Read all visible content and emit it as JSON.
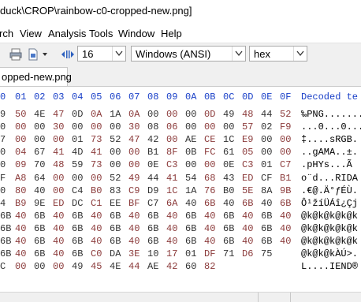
{
  "window": {
    "title": "duck\\CROP\\rainbow-c0-cropped-new.png]"
  },
  "menu": [
    "rch",
    "View",
    "Analysis",
    "Tools",
    "Window",
    "Help"
  ],
  "toolbar": {
    "bytes_per_row": "16",
    "charset": "Windows (ANSI)",
    "display_mode": "hex"
  },
  "tab": {
    "label": "opped-new.png"
  },
  "hex": {
    "columns": [
      "0",
      "01",
      "02",
      "03",
      "04",
      "05",
      "06",
      "07",
      "08",
      "09",
      "0A",
      "0B",
      "0C",
      "0D",
      "0E",
      "0F"
    ],
    "decoded_header": "Decoded te",
    "rows": [
      {
        "bytes": [
          "9",
          "50",
          "4E",
          "47",
          "0D",
          "0A",
          "1A",
          "0A",
          "00",
          "00",
          "00",
          "0D",
          "49",
          "48",
          "44",
          "52"
        ],
        "text": "‰PNG........"
      },
      {
        "bytes": [
          "0",
          "00",
          "00",
          "30",
          "00",
          "00",
          "00",
          "30",
          "08",
          "06",
          "00",
          "00",
          "00",
          "57",
          "02",
          "F9"
        ],
        "text": "...0...0..."
      },
      {
        "bytes": [
          "7",
          "00",
          "00",
          "00",
          "01",
          "73",
          "52",
          "47",
          "42",
          "00",
          "AE",
          "CE",
          "1C",
          "E9",
          "00",
          "00"
        ],
        "text": "‡....sRGB."
      },
      {
        "bytes": [
          "0",
          "04",
          "67",
          "41",
          "4D",
          "41",
          "00",
          "00",
          "B1",
          "8F",
          "0B",
          "FC",
          "61",
          "05",
          "00",
          "00"
        ],
        "text": "..gAMA..±."
      },
      {
        "bytes": [
          "0",
          "09",
          "70",
          "48",
          "59",
          "73",
          "00",
          "00",
          "0E",
          "C3",
          "00",
          "00",
          "0E",
          "C3",
          "01",
          "C7"
        ],
        "text": ".pHYs...Ã"
      },
      {
        "bytes": [
          "F",
          "A8",
          "64",
          "00",
          "00",
          "00",
          "52",
          "49",
          "44",
          "41",
          "54",
          "68",
          "43",
          "ED",
          "CF",
          "B1"
        ],
        "text": "o¨d...RIDA"
      },
      {
        "bytes": [
          "0",
          "80",
          "40",
          "00",
          "C4",
          "B0",
          "83",
          "C9",
          "D9",
          "1C",
          "1A",
          "76",
          "B0",
          "5E",
          "8A",
          "9B"
        ],
        "text": ".€@.Ä°ƒÉÙ."
      },
      {
        "bytes": [
          "4",
          "B9",
          "9E",
          "ED",
          "DC",
          "C1",
          "EE",
          "BF",
          "C7",
          "6A",
          "40",
          "6B",
          "40",
          "6B",
          "40",
          "6B"
        ],
        "text": "Ô¹žíÜÁî¿Çj"
      },
      {
        "bytes": [
          "6B",
          "40",
          "6B",
          "40",
          "6B",
          "40",
          "6B",
          "40",
          "6B",
          "40",
          "6B",
          "40",
          "6B",
          "40",
          "6B",
          "40"
        ],
        "text": "@k@k@k@k@k"
      },
      {
        "bytes": [
          "6B",
          "40",
          "6B",
          "40",
          "6B",
          "40",
          "6B",
          "40",
          "6B",
          "40",
          "6B",
          "40",
          "6B",
          "40",
          "6B",
          "40"
        ],
        "text": "@k@k@k@k@k"
      },
      {
        "bytes": [
          "6B",
          "40",
          "6B",
          "40",
          "6B",
          "40",
          "6B",
          "40",
          "6B",
          "40",
          "6B",
          "40",
          "6B",
          "40",
          "6B",
          "40"
        ],
        "text": "@k@k@k@k@k"
      },
      {
        "bytes": [
          "6B",
          "40",
          "6B",
          "40",
          "6B",
          "C0",
          "DA",
          "3E",
          "10",
          "17",
          "01",
          "DF",
          "71",
          "D6",
          "75",
          ""
        ],
        "text": "@k@k@kÀÚ>."
      },
      {
        "bytes": [
          "C",
          "00",
          "00",
          "00",
          "49",
          "45",
          "4E",
          "44",
          "AE",
          "42",
          "60",
          "82",
          "",
          "",
          "",
          ""
        ],
        "text": "L....IEND®"
      }
    ]
  },
  "colors": {
    "hex_header": "#1a40c8",
    "byte_alt": "#8b3a3a",
    "byte_main": "#333333"
  }
}
